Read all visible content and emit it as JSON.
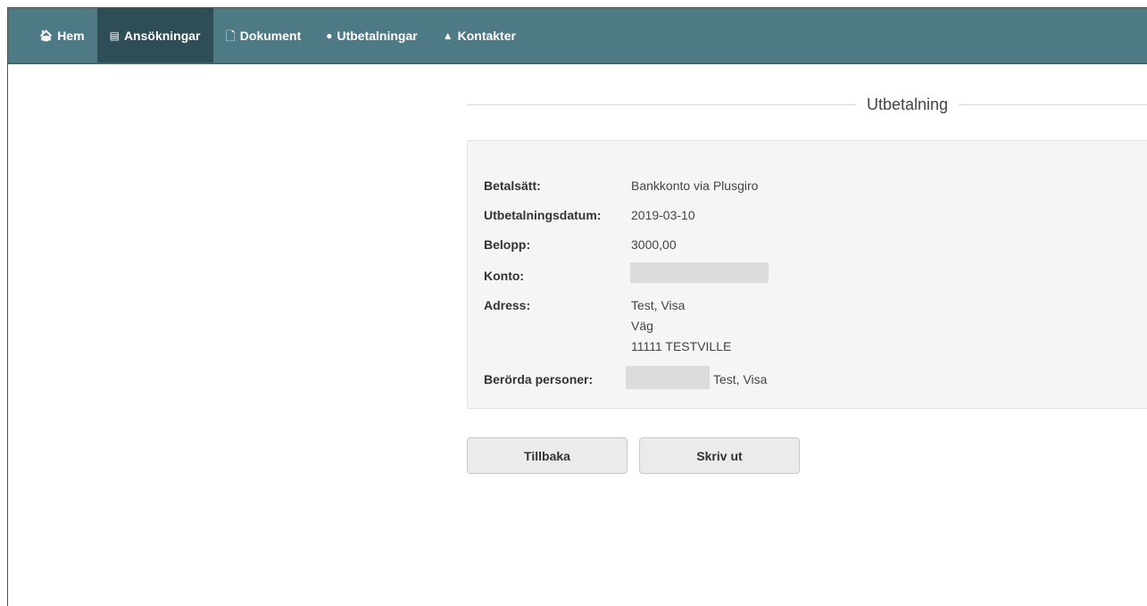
{
  "nav": {
    "items": [
      {
        "label": "Hem",
        "icon": "home-icon",
        "glyph": "🏠︎"
      },
      {
        "label": "Ansökningar",
        "icon": "clipboard-icon",
        "glyph": "▤",
        "active": true
      },
      {
        "label": "Dokument",
        "icon": "document-icon",
        "glyph": "🗋"
      },
      {
        "label": "Utbetalningar",
        "icon": "money-icon",
        "glyph": "●"
      },
      {
        "label": "Kontakter",
        "icon": "contacts-icon",
        "glyph": "▲"
      }
    ]
  },
  "section": {
    "title": "Utbetalning"
  },
  "details": {
    "payment_method_label": "Betalsätt:",
    "payment_method_value": "Bankkonto via Plusgiro",
    "payment_date_label": "Utbetalningsdatum:",
    "payment_date_value": "2019-03-10",
    "amount_label": "Belopp:",
    "amount_value": "3000,00",
    "account_label": "Konto:",
    "address_label": "Adress:",
    "address_line1": "Test, Visa",
    "address_line2": "Väg",
    "address_line3": "11111 TESTVILLE",
    "persons_label": "Berörda personer:",
    "persons_value": "Test, Visa"
  },
  "actions": {
    "back_label": "Tillbaka",
    "print_label": "Skriv ut"
  }
}
